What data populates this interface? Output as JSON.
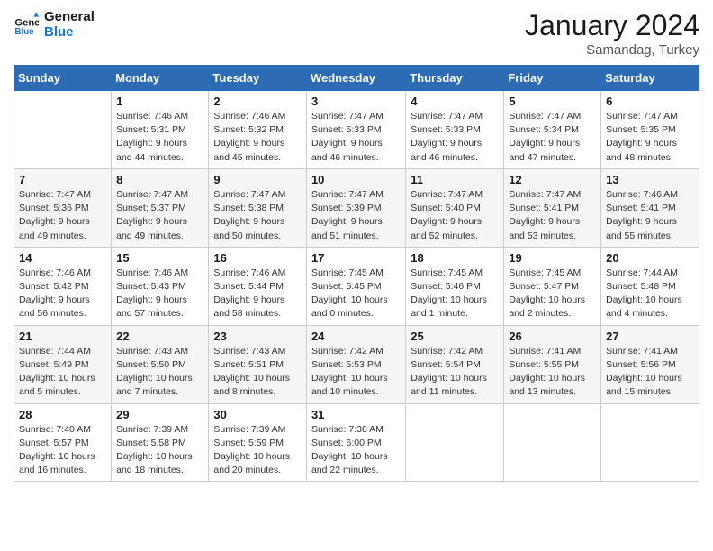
{
  "header": {
    "logo_line1": "General",
    "logo_line2": "Blue",
    "month": "January 2024",
    "location": "Samandag, Turkey"
  },
  "weekdays": [
    "Sunday",
    "Monday",
    "Tuesday",
    "Wednesday",
    "Thursday",
    "Friday",
    "Saturday"
  ],
  "weeks": [
    [
      {
        "day": "",
        "info": ""
      },
      {
        "day": "1",
        "info": "Sunrise: 7:46 AM\nSunset: 5:31 PM\nDaylight: 9 hours\nand 44 minutes."
      },
      {
        "day": "2",
        "info": "Sunrise: 7:46 AM\nSunset: 5:32 PM\nDaylight: 9 hours\nand 45 minutes."
      },
      {
        "day": "3",
        "info": "Sunrise: 7:47 AM\nSunset: 5:33 PM\nDaylight: 9 hours\nand 46 minutes."
      },
      {
        "day": "4",
        "info": "Sunrise: 7:47 AM\nSunset: 5:33 PM\nDaylight: 9 hours\nand 46 minutes."
      },
      {
        "day": "5",
        "info": "Sunrise: 7:47 AM\nSunset: 5:34 PM\nDaylight: 9 hours\nand 47 minutes."
      },
      {
        "day": "6",
        "info": "Sunrise: 7:47 AM\nSunset: 5:35 PM\nDaylight: 9 hours\nand 48 minutes."
      }
    ],
    [
      {
        "day": "7",
        "info": "Sunrise: 7:47 AM\nSunset: 5:36 PM\nDaylight: 9 hours\nand 49 minutes."
      },
      {
        "day": "8",
        "info": "Sunrise: 7:47 AM\nSunset: 5:37 PM\nDaylight: 9 hours\nand 49 minutes."
      },
      {
        "day": "9",
        "info": "Sunrise: 7:47 AM\nSunset: 5:38 PM\nDaylight: 9 hours\nand 50 minutes."
      },
      {
        "day": "10",
        "info": "Sunrise: 7:47 AM\nSunset: 5:39 PM\nDaylight: 9 hours\nand 51 minutes."
      },
      {
        "day": "11",
        "info": "Sunrise: 7:47 AM\nSunset: 5:40 PM\nDaylight: 9 hours\nand 52 minutes."
      },
      {
        "day": "12",
        "info": "Sunrise: 7:47 AM\nSunset: 5:41 PM\nDaylight: 9 hours\nand 53 minutes."
      },
      {
        "day": "13",
        "info": "Sunrise: 7:46 AM\nSunset: 5:41 PM\nDaylight: 9 hours\nand 55 minutes."
      }
    ],
    [
      {
        "day": "14",
        "info": "Sunrise: 7:46 AM\nSunset: 5:42 PM\nDaylight: 9 hours\nand 56 minutes."
      },
      {
        "day": "15",
        "info": "Sunrise: 7:46 AM\nSunset: 5:43 PM\nDaylight: 9 hours\nand 57 minutes."
      },
      {
        "day": "16",
        "info": "Sunrise: 7:46 AM\nSunset: 5:44 PM\nDaylight: 9 hours\nand 58 minutes."
      },
      {
        "day": "17",
        "info": "Sunrise: 7:45 AM\nSunset: 5:45 PM\nDaylight: 10 hours\nand 0 minutes."
      },
      {
        "day": "18",
        "info": "Sunrise: 7:45 AM\nSunset: 5:46 PM\nDaylight: 10 hours\nand 1 minute."
      },
      {
        "day": "19",
        "info": "Sunrise: 7:45 AM\nSunset: 5:47 PM\nDaylight: 10 hours\nand 2 minutes."
      },
      {
        "day": "20",
        "info": "Sunrise: 7:44 AM\nSunset: 5:48 PM\nDaylight: 10 hours\nand 4 minutes."
      }
    ],
    [
      {
        "day": "21",
        "info": "Sunrise: 7:44 AM\nSunset: 5:49 PM\nDaylight: 10 hours\nand 5 minutes."
      },
      {
        "day": "22",
        "info": "Sunrise: 7:43 AM\nSunset: 5:50 PM\nDaylight: 10 hours\nand 7 minutes."
      },
      {
        "day": "23",
        "info": "Sunrise: 7:43 AM\nSunset: 5:51 PM\nDaylight: 10 hours\nand 8 minutes."
      },
      {
        "day": "24",
        "info": "Sunrise: 7:42 AM\nSunset: 5:53 PM\nDaylight: 10 hours\nand 10 minutes."
      },
      {
        "day": "25",
        "info": "Sunrise: 7:42 AM\nSunset: 5:54 PM\nDaylight: 10 hours\nand 11 minutes."
      },
      {
        "day": "26",
        "info": "Sunrise: 7:41 AM\nSunset: 5:55 PM\nDaylight: 10 hours\nand 13 minutes."
      },
      {
        "day": "27",
        "info": "Sunrise: 7:41 AM\nSunset: 5:56 PM\nDaylight: 10 hours\nand 15 minutes."
      }
    ],
    [
      {
        "day": "28",
        "info": "Sunrise: 7:40 AM\nSunset: 5:57 PM\nDaylight: 10 hours\nand 16 minutes."
      },
      {
        "day": "29",
        "info": "Sunrise: 7:39 AM\nSunset: 5:58 PM\nDaylight: 10 hours\nand 18 minutes."
      },
      {
        "day": "30",
        "info": "Sunrise: 7:39 AM\nSunset: 5:59 PM\nDaylight: 10 hours\nand 20 minutes."
      },
      {
        "day": "31",
        "info": "Sunrise: 7:38 AM\nSunset: 6:00 PM\nDaylight: 10 hours\nand 22 minutes."
      },
      {
        "day": "",
        "info": ""
      },
      {
        "day": "",
        "info": ""
      },
      {
        "day": "",
        "info": ""
      }
    ]
  ]
}
